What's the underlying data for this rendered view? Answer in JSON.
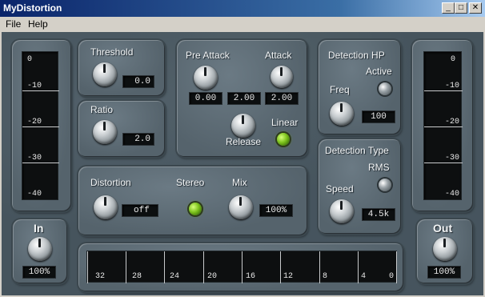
{
  "window": {
    "title": "MyDistortion"
  },
  "title_buttons": {
    "minimize": "_",
    "maximize": "□",
    "close": "✕"
  },
  "menu": {
    "file": "File",
    "help": "Help"
  },
  "in_meter": {
    "label": "In",
    "value": "100%",
    "scale": [
      "0",
      "-10",
      "-20",
      "-30",
      "-40"
    ]
  },
  "out_meter": {
    "label": "Out",
    "value": "100%",
    "scale": [
      "0",
      "-10",
      "-20",
      "-30",
      "-40"
    ]
  },
  "threshold": {
    "label": "Threshold",
    "value": "0.0"
  },
  "ratio": {
    "label": "Ratio",
    "value": "2.0"
  },
  "envelope": {
    "pre_attack_label": "Pre Attack",
    "attack_label": "Attack",
    "release_label": "Release",
    "linear_label": "Linear",
    "values": [
      "0.00",
      "2.00",
      "2.00"
    ]
  },
  "detection_hp": {
    "title": "Detection HP",
    "active_label": "Active",
    "freq_label": "Freq",
    "freq_value": "100"
  },
  "detection_type": {
    "title": "Detection Type",
    "rms_label": "RMS",
    "speed_label": "Speed",
    "speed_value": "4.5k"
  },
  "distortion": {
    "label": "Distortion",
    "value": "off",
    "stereo_label": "Stereo",
    "mix_label": "Mix",
    "mix_value": "100%"
  },
  "scope": {
    "scale": [
      "32",
      "28",
      "24",
      "20",
      "16",
      "12",
      "8",
      "4",
      "0"
    ]
  },
  "colors": {
    "led_green": "#7cc21c",
    "panel": "#5c6a73",
    "background": "#46545d"
  }
}
